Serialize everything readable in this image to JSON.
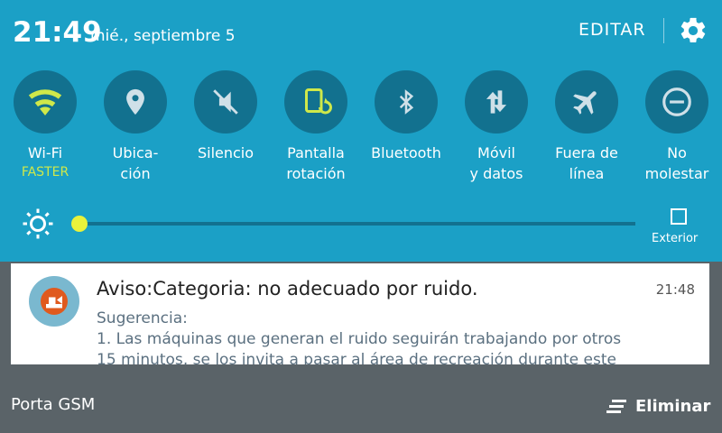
{
  "status": {
    "time": "21:49",
    "date": "mié., septiembre 5"
  },
  "header": {
    "edit_label": "EDITAR",
    "settings_icon": "gear-icon"
  },
  "quick_settings": [
    {
      "label": "Wi-Fi",
      "sub": "FASTER",
      "icon": "wifi-icon",
      "active": true
    },
    {
      "label": "Ubica-\nción",
      "icon": "location-icon"
    },
    {
      "label": "Silencio",
      "icon": "mute-icon"
    },
    {
      "label": "Pantalla\nrotación",
      "icon": "rotation-icon"
    },
    {
      "label": "Bluetooth",
      "icon": "bluetooth-icon"
    },
    {
      "label": "Móvil\ny datos",
      "icon": "mobile-data-icon"
    },
    {
      "label": "Fuera de\nlínea",
      "icon": "airplane-icon"
    },
    {
      "label": "No\nmolestar",
      "icon": "do-not-disturb-icon"
    }
  ],
  "brightness": {
    "level": 0.0,
    "outdoor_label": "Exterior",
    "outdoor_checked": false
  },
  "notification": {
    "title": "Aviso:Categoria: no adecuado por ruido.",
    "time": "21:48",
    "line1": "Sugerencia:",
    "line2": "1. Las máquinas que generan el ruido seguirán trabajando por otros",
    "line3": "15 minutos, se los invita a pasar al área de recreación durante este"
  },
  "footer": {
    "carrier": "Porta GSM",
    "clear_label": "Eliminar"
  },
  "colors": {
    "panel_bg": "#1ba0c6",
    "tile_bg": "#12718f",
    "accent": "#cfe84a",
    "shade_bg": "#5a6368"
  }
}
